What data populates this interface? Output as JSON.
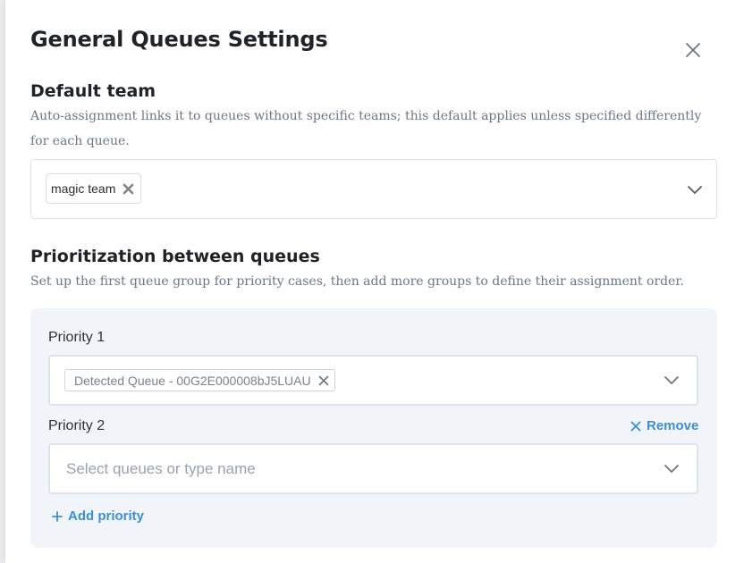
{
  "modal": {
    "title": "General Queues Settings"
  },
  "default_team": {
    "title": "Default team",
    "description": "Auto-assignment links it to queues without specific teams; this default applies unless specified differently for each queue.",
    "selected": [
      "magic team"
    ]
  },
  "prioritization": {
    "title": "Prioritization between queues",
    "description": "Set up the first queue group for priority cases, then add more groups to define their assignment order.",
    "priorities": [
      {
        "label": "Priority 1",
        "selected": [
          "Detected Queue - 00G2E000008bJ5LUAU"
        ],
        "placeholder": ""
      },
      {
        "label": "Priority 2",
        "selected": [],
        "placeholder": "Select queues or type name"
      }
    ],
    "remove_label": "Remove",
    "add_label": "Add priority"
  },
  "colors": {
    "accent": "#3d8fd8",
    "panel": "#f1f5f9",
    "heading": "#1f2328",
    "muted": "#6b7785"
  },
  "icons": [
    "close-icon",
    "chip-remove-icon",
    "chevron-down-icon",
    "plus-icon"
  ]
}
